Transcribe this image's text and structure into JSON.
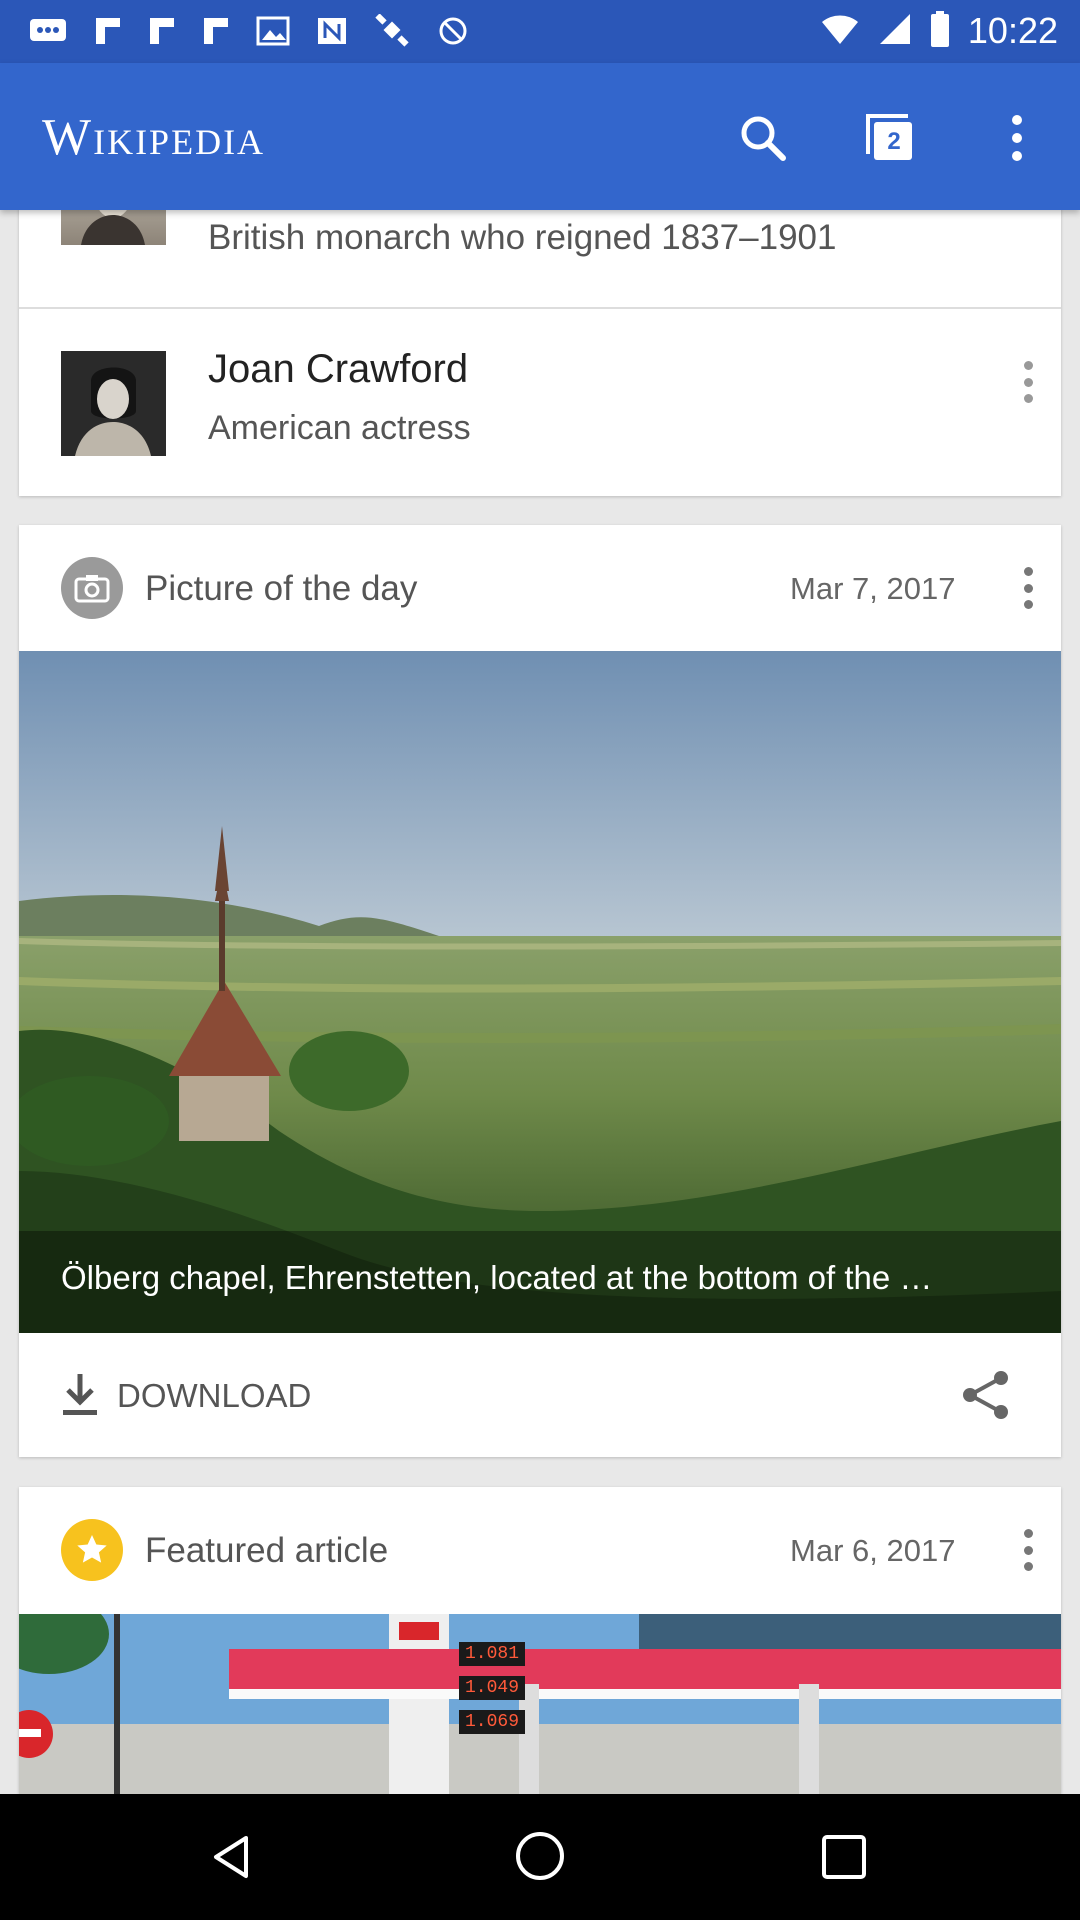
{
  "status_bar": {
    "time": "10:22"
  },
  "app_bar": {
    "logo": "Wikipedia",
    "tabs_count": "2",
    "icons": [
      "search-icon",
      "tabs-icon",
      "overflow-menu-icon"
    ]
  },
  "list": {
    "items": [
      {
        "description": "British monarch who reigned 1837–1901"
      },
      {
        "title": "Joan Crawford",
        "description": "American actress"
      }
    ]
  },
  "picture_of_the_day": {
    "header": "Picture of the day",
    "date": "Mar 7, 2017",
    "caption": "Ölberg chapel, Ehrenstetten, located at the bottom of the …",
    "download_label": "DOWNLOAD"
  },
  "featured_article": {
    "header": "Featured article",
    "date": "Mar 6, 2017",
    "gas_prices": [
      "1.081",
      "1.049",
      "1.069"
    ]
  },
  "colors": {
    "app_bar": "#3366cc",
    "status_bar": "#2b57b8",
    "featured_star": "#f7c21e",
    "nav_bar": "#000000"
  }
}
